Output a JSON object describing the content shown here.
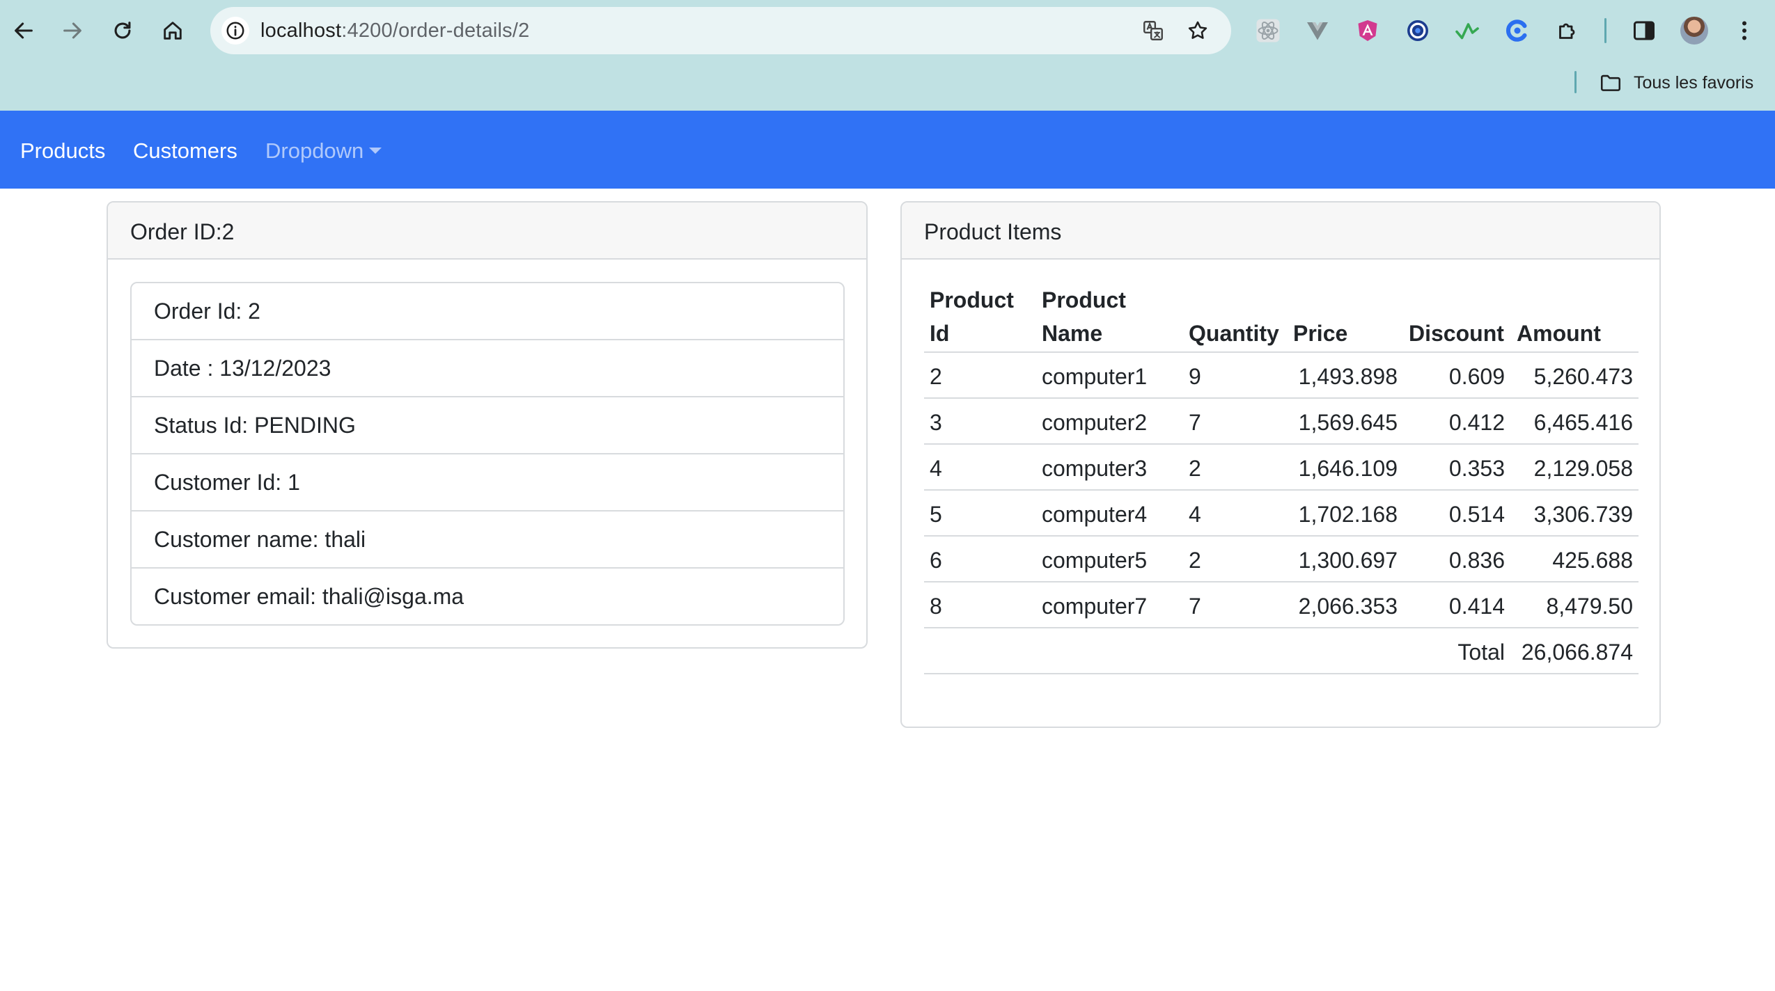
{
  "browser": {
    "url_host": "localhost",
    "url_path": ":4200/order-details/2",
    "bookmarks_label": "Tous les favoris"
  },
  "navbar": {
    "links": [
      "Products",
      "Customers"
    ],
    "dropdown_label": "Dropdown"
  },
  "order_card": {
    "header": "Order ID:2",
    "items": [
      "Order Id: 2",
      "Date : 13/12/2023",
      "Status Id: PENDING",
      "Customer Id: 1",
      "Customer name: thali",
      "Customer email: thali@isga.ma"
    ]
  },
  "items_card": {
    "header": "Product Items",
    "columns": {
      "product_id_1": "Product",
      "product_id_2": "Id",
      "product_name_1": "Product",
      "product_name_2": "Name",
      "quantity": "Quantity",
      "price": "Price",
      "discount": "Discount",
      "amount": "Amount"
    },
    "rows": [
      {
        "id": "2",
        "name": "computer1",
        "quantity": "9",
        "price": "1,493.898",
        "discount": "0.609",
        "amount": "5,260.473"
      },
      {
        "id": "3",
        "name": "computer2",
        "quantity": "7",
        "price": "1,569.645",
        "discount": "0.412",
        "amount": "6,465.416"
      },
      {
        "id": "4",
        "name": "computer3",
        "quantity": "2",
        "price": "1,646.109",
        "discount": "0.353",
        "amount": "2,129.058"
      },
      {
        "id": "5",
        "name": "computer4",
        "quantity": "4",
        "price": "1,702.168",
        "discount": "0.514",
        "amount": "3,306.739"
      },
      {
        "id": "6",
        "name": "computer5",
        "quantity": "2",
        "price": "1,300.697",
        "discount": "0.836",
        "amount": "425.688"
      },
      {
        "id": "8",
        "name": "computer7",
        "quantity": "7",
        "price": "2,066.353",
        "discount": "0.414",
        "amount": "8,479.50"
      }
    ],
    "total_label": "Total",
    "total_value": "26,066.874"
  }
}
